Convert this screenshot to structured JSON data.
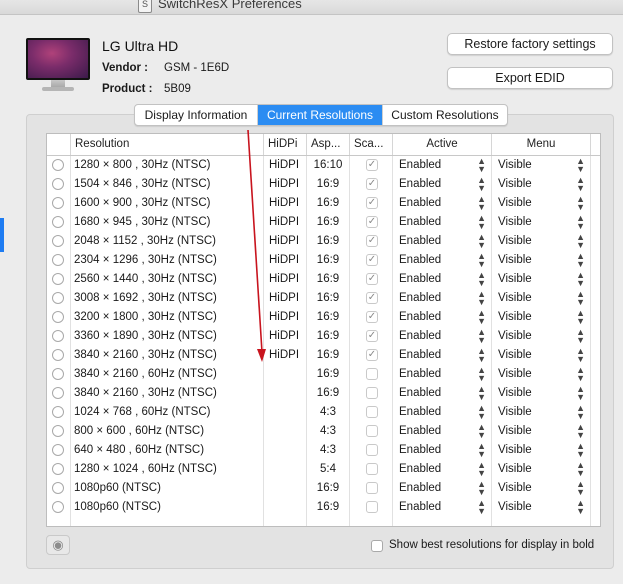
{
  "window": {
    "title": "SwitchResX Preferences",
    "icon": "switchresx-app-icon"
  },
  "display": {
    "name": "LG Ultra HD",
    "vendor_label": "Vendor :",
    "vendor_value": "GSM - 1E6D",
    "product_label": "Product :",
    "product_value": "5B09"
  },
  "buttons": {
    "restore": "Restore factory settings",
    "export": "Export EDID"
  },
  "tabs": [
    {
      "label": "Display Information",
      "active": false
    },
    {
      "label": "Current Resolutions",
      "active": true
    },
    {
      "label": "Custom Resolutions",
      "active": false
    }
  ],
  "table": {
    "headers": {
      "resolution": "Resolution",
      "hidpi": "HiDPi",
      "aspect": "Asp...",
      "scaled": "Sca...",
      "active": "Active",
      "menu": "Menu"
    },
    "rows": [
      {
        "resolution": "1280 × 800   , 30Hz (NTSC)",
        "hidpi": "HiDPI",
        "aspect": "16:10",
        "scaled": true,
        "active": "Enabled",
        "menu": "Visible"
      },
      {
        "resolution": "1504 × 846   , 30Hz (NTSC)",
        "hidpi": "HiDPI",
        "aspect": "16:9",
        "scaled": true,
        "active": "Enabled",
        "menu": "Visible"
      },
      {
        "resolution": "1600 × 900   , 30Hz (NTSC)",
        "hidpi": "HiDPI",
        "aspect": "16:9",
        "scaled": true,
        "active": "Enabled",
        "menu": "Visible"
      },
      {
        "resolution": "1680 × 945   , 30Hz (NTSC)",
        "hidpi": "HiDPI",
        "aspect": "16:9",
        "scaled": true,
        "active": "Enabled",
        "menu": "Visible"
      },
      {
        "resolution": "2048 × 1152 , 30Hz (NTSC)",
        "hidpi": "HiDPI",
        "aspect": "16:9",
        "scaled": true,
        "active": "Enabled",
        "menu": "Visible"
      },
      {
        "resolution": "2304 × 1296 , 30Hz (NTSC)",
        "hidpi": "HiDPI",
        "aspect": "16:9",
        "scaled": true,
        "active": "Enabled",
        "menu": "Visible"
      },
      {
        "resolution": "2560 × 1440 , 30Hz (NTSC)",
        "hidpi": "HiDPI",
        "aspect": "16:9",
        "scaled": true,
        "active": "Enabled",
        "menu": "Visible"
      },
      {
        "resolution": "3008 × 1692 , 30Hz (NTSC)",
        "hidpi": "HiDPI",
        "aspect": "16:9",
        "scaled": true,
        "active": "Enabled",
        "menu": "Visible"
      },
      {
        "resolution": "3200 × 1800 , 30Hz (NTSC)",
        "hidpi": "HiDPI",
        "aspect": "16:9",
        "scaled": true,
        "active": "Enabled",
        "menu": "Visible"
      },
      {
        "resolution": "3360 × 1890 , 30Hz (NTSC)",
        "hidpi": "HiDPI",
        "aspect": "16:9",
        "scaled": true,
        "active": "Enabled",
        "menu": "Visible"
      },
      {
        "resolution": "3840 × 2160 , 30Hz (NTSC)",
        "hidpi": "HiDPI",
        "aspect": "16:9",
        "scaled": true,
        "active": "Enabled",
        "menu": "Visible"
      },
      {
        "resolution": "3840 × 2160 , 60Hz (NTSC)",
        "hidpi": "",
        "aspect": "16:9",
        "scaled": false,
        "active": "Enabled",
        "menu": "Visible"
      },
      {
        "resolution": "3840 × 2160 , 30Hz (NTSC)",
        "hidpi": "",
        "aspect": "16:9",
        "scaled": false,
        "active": "Enabled",
        "menu": "Visible"
      },
      {
        "resolution": "1024 × 768   , 60Hz (NTSC)",
        "hidpi": "",
        "aspect": "4:3",
        "scaled": false,
        "active": "Enabled",
        "menu": "Visible"
      },
      {
        "resolution": "  800 × 600   , 60Hz (NTSC)",
        "hidpi": "",
        "aspect": "4:3",
        "scaled": false,
        "active": "Enabled",
        "menu": "Visible"
      },
      {
        "resolution": "  640 × 480   , 60Hz (NTSC)",
        "hidpi": "",
        "aspect": "4:3",
        "scaled": false,
        "active": "Enabled",
        "menu": "Visible"
      },
      {
        "resolution": "1280 × 1024 , 60Hz (NTSC)",
        "hidpi": "",
        "aspect": "5:4",
        "scaled": false,
        "active": "Enabled",
        "menu": "Visible"
      },
      {
        "resolution": "1080p60 (NTSC)",
        "hidpi": "",
        "aspect": "16:9",
        "scaled": false,
        "active": "Enabled",
        "menu": "Visible"
      },
      {
        "resolution": "1080p60 (NTSC)",
        "hidpi": "",
        "aspect": "16:9",
        "scaled": false,
        "active": "Enabled",
        "menu": "Visible"
      }
    ]
  },
  "footer": {
    "eye_icon": "eye-icon",
    "show_best_label": "Show best resolutions for display in bold",
    "show_best_checked": false
  },
  "colors": {
    "accent": "#2b8cf2",
    "annotation_arrow": "#c8141e"
  }
}
